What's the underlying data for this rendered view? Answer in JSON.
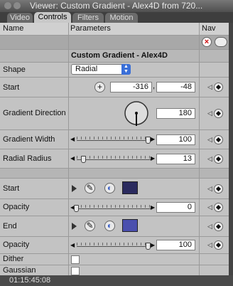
{
  "window": {
    "title": "Viewer: Custom Gradient - Alex4D from 720..."
  },
  "tabs": [
    {
      "label": "Video"
    },
    {
      "label": "Controls"
    },
    {
      "label": "Filters"
    },
    {
      "label": "Motion"
    }
  ],
  "header": {
    "name_col": "Name",
    "params_col": "Parameters",
    "nav_col": "Nav"
  },
  "filter_name": "Custom Gradient - Alex4D",
  "params": {
    "shape": {
      "label": "Shape",
      "value": "Radial"
    },
    "start": {
      "label": "Start",
      "x": "-316",
      "y": "-48"
    },
    "gradient_direction": {
      "label": "Gradient Direction",
      "value": "180"
    },
    "gradient_width": {
      "label": "Gradient Width",
      "value": "100",
      "level": 1.0
    },
    "radial_radius": {
      "label": "Radial Radius",
      "value": "13",
      "level": 0.13
    },
    "start_color": {
      "label": "Start",
      "color": "#2a2a5e"
    },
    "opacity1": {
      "label": "Opacity",
      "value": "0",
      "level": 0.0
    },
    "end_color": {
      "label": "End",
      "color": "#4a4fae"
    },
    "opacity2": {
      "label": "Opacity",
      "value": "100",
      "level": 1.0
    },
    "dither": {
      "label": "Dither",
      "checked": false
    },
    "gaussian": {
      "label": "Gaussian",
      "checked": false
    }
  },
  "status": {
    "timecode": "01:15:45:08"
  }
}
